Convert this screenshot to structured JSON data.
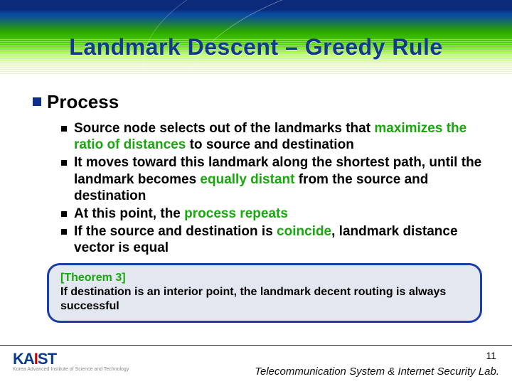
{
  "title": "Landmark Descent – Greedy Rule",
  "section_heading": "Process",
  "bullets": [
    {
      "pre": "Source node selects out of the landmarks that ",
      "em": "maximizes the ratio of distances",
      "post": " to source and destination"
    },
    {
      "pre": "It moves toward this landmark along the shortest path, until the landmark becomes ",
      "em": "equally distant",
      "post": " from the source and destination"
    },
    {
      "pre": "At this point, the ",
      "em": "process repeats",
      "post": ""
    },
    {
      "pre": "If the source and destination is ",
      "em": "coincide",
      "post": ", landmark distance vector is equal"
    }
  ],
  "theorem": {
    "label": "[Theorem 3]",
    "text": "If destination is an interior point, the landmark decent routing is always successful"
  },
  "footer": {
    "logo": "KAIST",
    "logo_sub": "Korea Advanced Institute of Science and Technology",
    "page": "11",
    "lab": "Telecommunication System & Internet Security Lab."
  }
}
